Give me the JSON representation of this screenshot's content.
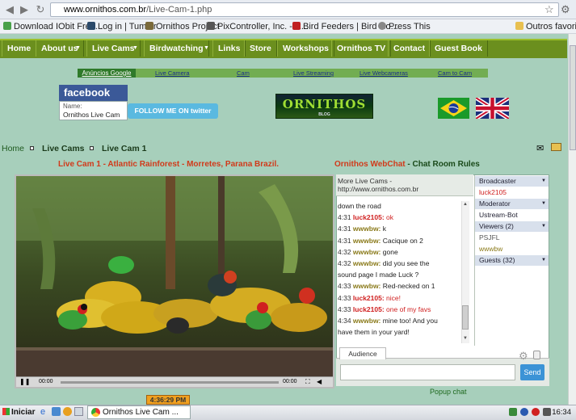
{
  "browser": {
    "url_host": "www.ornithos.com.br",
    "url_path": "/Live-Cam-1.php",
    "bookmarks": [
      {
        "label": "Download IObit Free...",
        "color": "#4aa14a"
      },
      {
        "label": "Log in | Tumblr",
        "color": "#2b4a6a"
      },
      {
        "label": "Ornithos Project",
        "color": "#7a6a3a"
      },
      {
        "label": "PixController, Inc. - R...",
        "color": "#555555"
      },
      {
        "label": "Bird Feeders | Bird Ho...",
        "color": "#c02020"
      },
      {
        "label": "Press This",
        "color": "#888888"
      }
    ],
    "other_bookmarks": "Outros favoritos"
  },
  "site_nav": [
    "Home",
    "About us",
    "Live Cams",
    "Birdwatching",
    "Links",
    "Store",
    "Workshops",
    "Ornithos TV",
    "Contact",
    "Guest Book"
  ],
  "sub_nav": {
    "ads": "Anúncios Google",
    "links": [
      "Live Camera",
      "Cam",
      "Live Streaming",
      "Live Webcameras",
      "Cam to Cam"
    ]
  },
  "facebook": {
    "title": "facebook",
    "name_label": "Name:",
    "name": "Ornithos Live Cam",
    "twitter": "FOLLOW ME ON twitter"
  },
  "logo": {
    "text": "ORNITHOS",
    "sub": "BLOG"
  },
  "breadcrumb": [
    "Home",
    "Live Cams",
    "Live Cam 1"
  ],
  "cam_title": "Live Cam 1 - Atlantic Rainforest - Morretes, Parana Brazil.",
  "chat_title": {
    "red": "Ornithos WebChat",
    "sep": " - ",
    "green": "Chat Room Rules"
  },
  "video": {
    "time_left": "00:00",
    "time_right": "00:00"
  },
  "chat": {
    "header_line1": "More Live Cams -",
    "header_line2": "http://www.ornithos.com.br",
    "messages": [
      {
        "time": "",
        "user": "",
        "text": "down the road",
        "kind": "plain"
      },
      {
        "time": "4:31",
        "user": "luck2105:",
        "text": "ok",
        "kind": "luck"
      },
      {
        "time": "4:31",
        "user": "wwwbw:",
        "text": "k",
        "kind": "ww"
      },
      {
        "time": "4:31",
        "user": "wwwbw:",
        "text": "Cacique on 2",
        "kind": "ww"
      },
      {
        "time": "4:32",
        "user": "wwwbw:",
        "text": "gone",
        "kind": "ww"
      },
      {
        "time": "4:32",
        "user": "wwwbw:",
        "text": "did you see the",
        "kind": "ww"
      },
      {
        "time": "",
        "user": "",
        "text": "sound page I made Luck ?",
        "kind": "plain"
      },
      {
        "time": "4:33",
        "user": "wwwbw:",
        "text": "Red-necked on 1",
        "kind": "ww"
      },
      {
        "time": "4:33",
        "user": "luck2105:",
        "text": "nice!",
        "kind": "luck"
      },
      {
        "time": "4:33",
        "user": "luck2105:",
        "text": "one of my favs",
        "kind": "luck"
      },
      {
        "time": "4:34",
        "user": "wwwbw:",
        "text": "mine too! And you",
        "kind": "ww"
      },
      {
        "time": "",
        "user": "",
        "text": "have them in your yard!",
        "kind": "plain"
      }
    ],
    "panel": {
      "broadcaster_label": "Broadcaster",
      "broadcaster": "luck2105",
      "moderator_label": "Moderator",
      "moderator": "Ustream-Bot",
      "viewers_label": "Viewers (2)",
      "viewers": [
        "PSJFL",
        "wwwbw"
      ],
      "guests_label": "Guests (32)"
    },
    "audience_tab": "Audience",
    "send": "Send",
    "popup": "Popup chat"
  },
  "clock_badge": "4:36:29 PM",
  "taskbar": {
    "start": "Iniciar",
    "window": "Ornithos Live Cam ...",
    "time": "16:34"
  }
}
